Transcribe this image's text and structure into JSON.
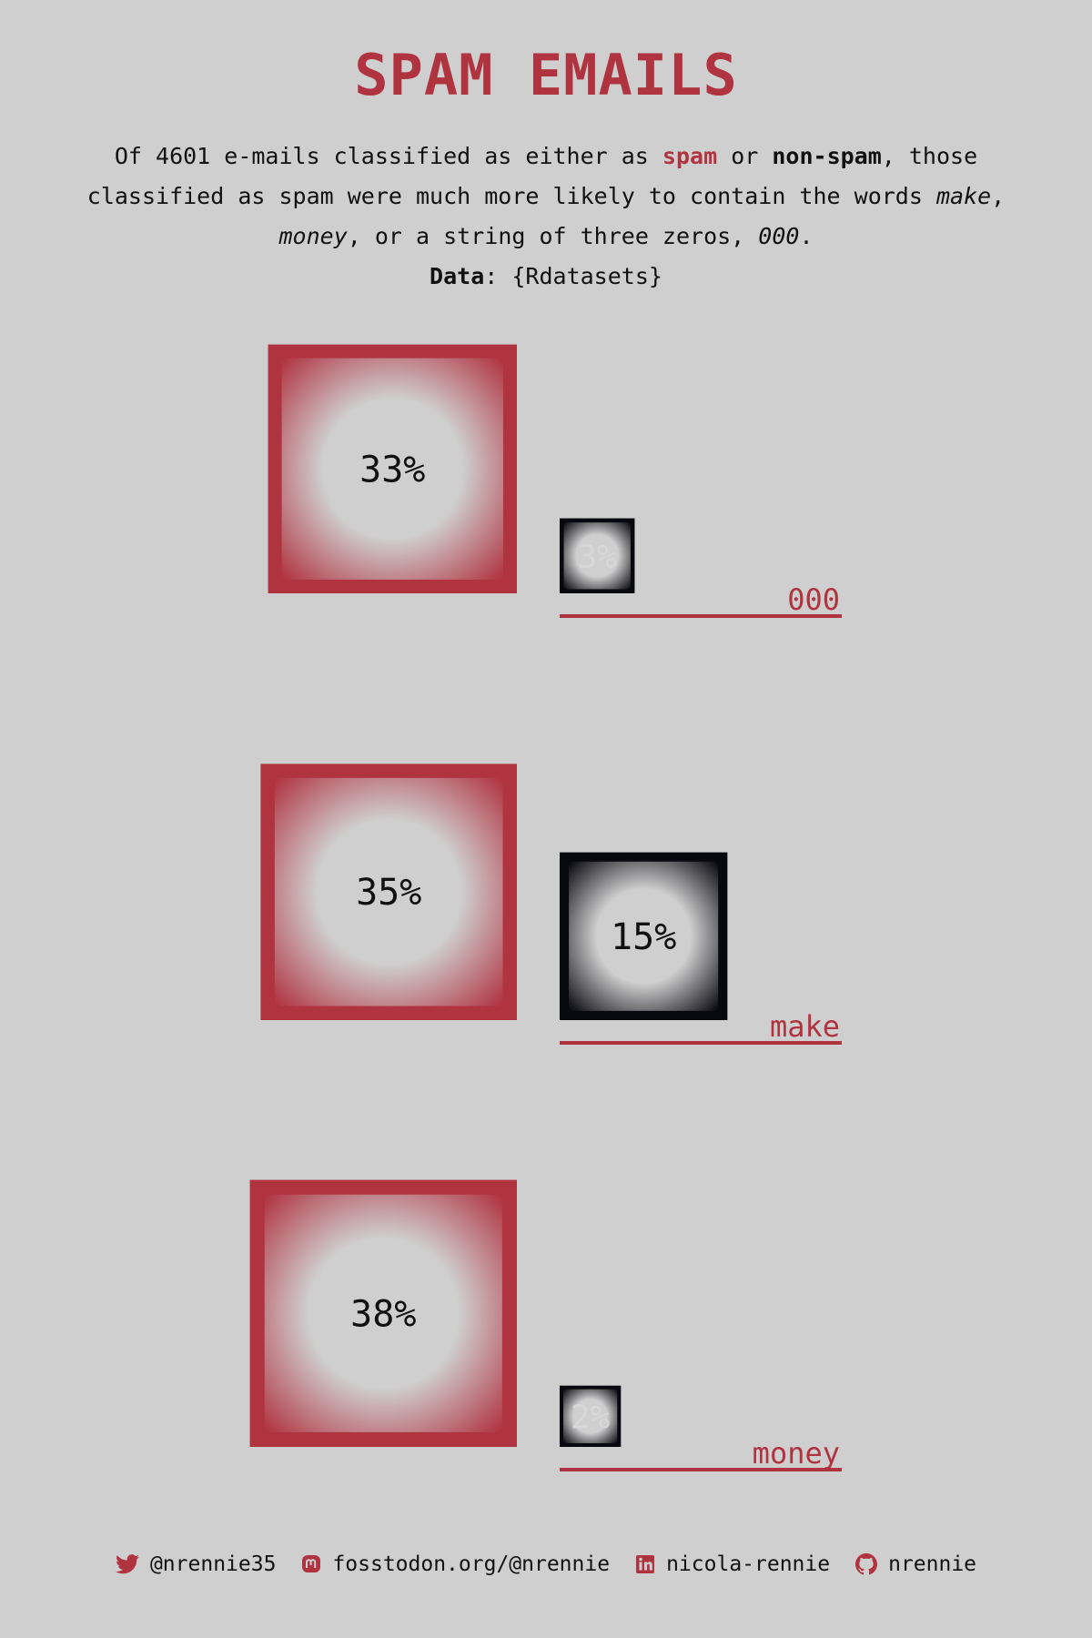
{
  "colors": {
    "background": "#cfcfcf",
    "spam": "#b03340",
    "non_spam": "#08080f",
    "text": "#111111"
  },
  "header": {
    "title": "SPAM EMAILS",
    "sub_part1": "Of 4601 e-mails classified as either as ",
    "spam_word": "spam",
    "sub_part2": " or ",
    "nonspam_word": "non-spam",
    "sub_part3": ", those classified as spam were much more likely to contain the words ",
    "word_make": "make",
    "sep1": ", ",
    "word_money": "money",
    "sub_part4": ", or a string of three zeros, ",
    "word_000": "000",
    "sub_part5": ".",
    "source_label": "Data",
    "source_value": ": {Rdatasets}"
  },
  "chart_data": {
    "type": "bar",
    "encoding": "square area proportional to percentage",
    "categories": [
      "000",
      "make",
      "money"
    ],
    "series": [
      {
        "name": "spam",
        "color": "#b03340",
        "values": [
          33,
          35,
          38
        ],
        "labels": [
          "33%",
          "35%",
          "38%"
        ]
      },
      {
        "name": "non-spam",
        "color": "#08080f",
        "values": [
          3,
          15,
          2
        ],
        "labels": [
          "3%",
          "15%",
          "2%"
        ]
      }
    ]
  },
  "footer": {
    "twitter": "@nrennie35",
    "mastodon": "fosstodon.org/@nrennie",
    "linkedin": "nicola-rennie",
    "github": "nrennie"
  }
}
